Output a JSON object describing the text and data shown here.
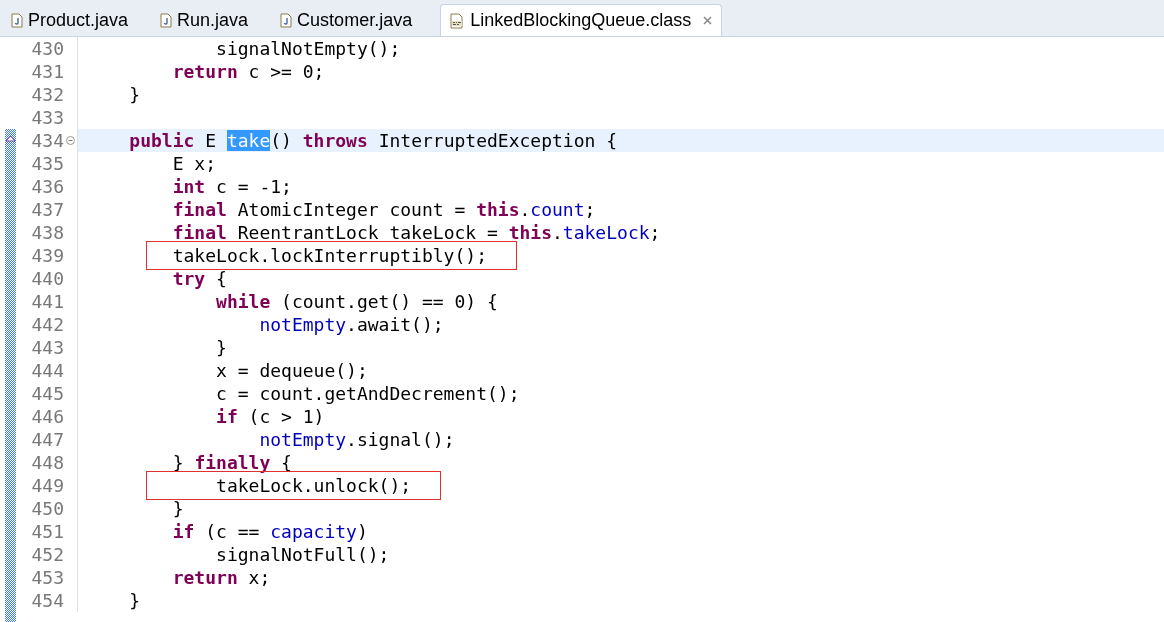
{
  "tabs": [
    {
      "label": "Product.java",
      "kind": "java",
      "selected": false
    },
    {
      "label": "Run.java",
      "kind": "java",
      "selected": false
    },
    {
      "label": "Customer.java",
      "kind": "java",
      "selected": false
    },
    {
      "label": "LinkedBlockingQueue.class",
      "kind": "class",
      "selected": true
    }
  ],
  "lines": [
    {
      "number": "430",
      "current": false,
      "fold": false,
      "boxed": false,
      "segments": [
        {
          "text": "            signalNotEmpty();",
          "kind": "plain"
        }
      ]
    },
    {
      "number": "431",
      "current": false,
      "fold": false,
      "boxed": false,
      "segments": [
        {
          "text": "        return",
          "kind": "keyword"
        },
        {
          "text": " c >= 0;",
          "kind": "plain"
        }
      ]
    },
    {
      "number": "432",
      "current": false,
      "fold": false,
      "boxed": false,
      "segments": [
        {
          "text": "    }",
          "kind": "plain"
        }
      ]
    },
    {
      "number": "433",
      "current": false,
      "fold": false,
      "boxed": false
    },
    {
      "number": "434",
      "current": true,
      "fold": true,
      "boxed": false,
      "segments": [
        {
          "text": "    public",
          "kind": "keyword"
        },
        {
          "text": " E ",
          "kind": "plain"
        },
        {
          "text": "take",
          "kind": "selected"
        },
        {
          "text": "() ",
          "kind": "plain"
        },
        {
          "text": "throws",
          "kind": "keyword"
        },
        {
          "text": " InterruptedException {",
          "kind": "plain"
        }
      ]
    },
    {
      "number": "435",
      "current": false,
      "fold": false,
      "boxed": false,
      "segments": [
        {
          "text": "        E x;",
          "kind": "plain"
        }
      ]
    },
    {
      "number": "436",
      "current": false,
      "fold": false,
      "boxed": false,
      "segments": [
        {
          "text": "        int",
          "kind": "keyword"
        },
        {
          "text": " c = -1;",
          "kind": "plain"
        }
      ]
    },
    {
      "number": "437",
      "current": false,
      "fold": false,
      "boxed": false,
      "segments": [
        {
          "text": "        final",
          "kind": "keyword"
        },
        {
          "text": " AtomicInteger count = ",
          "kind": "plain"
        },
        {
          "text": "this",
          "kind": "keyword"
        },
        {
          "text": ".",
          "kind": "plain"
        },
        {
          "text": "count",
          "kind": "field"
        },
        {
          "text": ";",
          "kind": "plain"
        }
      ]
    },
    {
      "number": "438",
      "current": false,
      "fold": false,
      "boxed": false,
      "segments": [
        {
          "text": "        final",
          "kind": "keyword"
        },
        {
          "text": " ReentrantLock takeLock = ",
          "kind": "plain"
        },
        {
          "text": "this",
          "kind": "keyword"
        },
        {
          "text": ".",
          "kind": "plain"
        },
        {
          "text": "takeLock",
          "kind": "field"
        },
        {
          "text": ";",
          "kind": "plain"
        }
      ]
    },
    {
      "number": "439",
      "current": false,
      "fold": false,
      "boxed": true,
      "segments": [
        {
          "text": "        takeLock.lockInterruptibly();",
          "kind": "plain"
        }
      ]
    },
    {
      "number": "440",
      "current": false,
      "fold": false,
      "boxed": false,
      "segments": [
        {
          "text": "        try",
          "kind": "keyword"
        },
        {
          "text": " {",
          "kind": "plain"
        }
      ]
    },
    {
      "number": "441",
      "current": false,
      "fold": false,
      "boxed": false,
      "segments": [
        {
          "text": "            while",
          "kind": "keyword"
        },
        {
          "text": " (count.get() == 0) {",
          "kind": "plain"
        }
      ]
    },
    {
      "number": "442",
      "current": false,
      "fold": false,
      "boxed": false,
      "segments": [
        {
          "text": "                notEmpty",
          "kind": "field"
        },
        {
          "text": ".await();",
          "kind": "plain"
        }
      ]
    },
    {
      "number": "443",
      "current": false,
      "fold": false,
      "boxed": false,
      "segments": [
        {
          "text": "            }",
          "kind": "plain"
        }
      ]
    },
    {
      "number": "444",
      "current": false,
      "fold": false,
      "boxed": false,
      "segments": [
        {
          "text": "            x = dequeue();",
          "kind": "plain"
        }
      ]
    },
    {
      "number": "445",
      "current": false,
      "fold": false,
      "boxed": false,
      "segments": [
        {
          "text": "            c = count.getAndDecrement();",
          "kind": "plain"
        }
      ]
    },
    {
      "number": "446",
      "current": false,
      "fold": false,
      "boxed": false,
      "segments": [
        {
          "text": "            if",
          "kind": "keyword"
        },
        {
          "text": " (c > 1)",
          "kind": "plain"
        }
      ]
    },
    {
      "number": "447",
      "current": false,
      "fold": false,
      "boxed": false,
      "segments": [
        {
          "text": "                notEmpty",
          "kind": "field"
        },
        {
          "text": ".signal();",
          "kind": "plain"
        }
      ]
    },
    {
      "number": "448",
      "current": false,
      "fold": false,
      "boxed": false,
      "segments": [
        {
          "text": "        } ",
          "kind": "plain"
        },
        {
          "text": "finally",
          "kind": "keyword"
        },
        {
          "text": " {",
          "kind": "plain"
        }
      ]
    },
    {
      "number": "449",
      "current": false,
      "fold": false,
      "boxed": true,
      "segments": [
        {
          "text": "            takeLock.unlock();",
          "kind": "plain"
        }
      ]
    },
    {
      "number": "450",
      "current": false,
      "fold": false,
      "boxed": false,
      "segments": [
        {
          "text": "        }",
          "kind": "plain"
        }
      ]
    },
    {
      "number": "451",
      "current": false,
      "fold": false,
      "boxed": false,
      "segments": [
        {
          "text": "        if",
          "kind": "keyword"
        },
        {
          "text": " (c == ",
          "kind": "plain"
        },
        {
          "text": "capacity",
          "kind": "field"
        },
        {
          "text": ")",
          "kind": "plain"
        }
      ]
    },
    {
      "number": "452",
      "current": false,
      "fold": false,
      "boxed": false,
      "segments": [
        {
          "text": "            signalNotFull();",
          "kind": "plain"
        }
      ]
    },
    {
      "number": "453",
      "current": false,
      "fold": false,
      "boxed": false,
      "segments": [
        {
          "text": "        return",
          "kind": "keyword"
        },
        {
          "text": " x;",
          "kind": "plain"
        }
      ]
    },
    {
      "number": "454",
      "current": false,
      "fold": false,
      "boxed": false,
      "segments": [
        {
          "text": "    }",
          "kind": "plain"
        }
      ]
    }
  ]
}
